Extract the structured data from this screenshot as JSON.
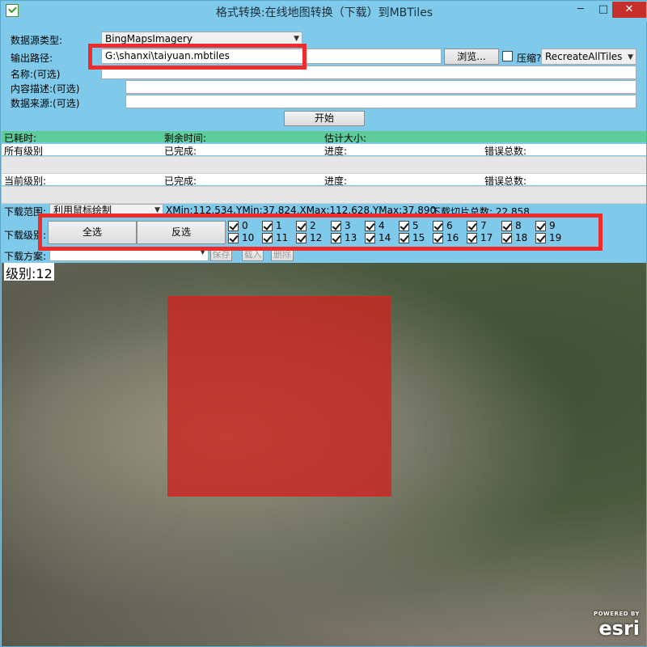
{
  "window": {
    "title": "格式转换:在线地图转换（下载）到MBTiles",
    "min": "─",
    "max": "□",
    "close": "✕"
  },
  "form": {
    "source_type_label": "数据源类型:",
    "source_type_value": "BingMapsImagery",
    "output_path_label": "输出路径:",
    "output_path_value": "G:\\shanxi\\taiyuan.mbtiles",
    "browse_button": "浏览...",
    "compress_label": "压缩?",
    "compress_checked": false,
    "mode_value": "RecreateAllTiles",
    "name_label": "名称:(可选)",
    "name_value": "",
    "description_label": "内容描述:(可选)",
    "description_value": "",
    "source_label": "数据来源:(可选)",
    "source_value": "",
    "start_button": "开始"
  },
  "progress": {
    "elapsed_label": "已耗时:",
    "remaining_label": "剩余时间:",
    "estimated_size_label": "估计大小:",
    "all_levels_label": "所有级别",
    "current_level_label": "当前级别:",
    "completed_label": "已完成:",
    "progress_label": "进度:",
    "errors_label": "错误总数:"
  },
  "download": {
    "range_label": "下载范围:",
    "range_value": "利用鼠标绘制",
    "extent_text": "XMin:112.534,YMin:37.824,XMax:112.628,YMax:37.890",
    "tile_count_text": "下载切片总数: 22,858",
    "levels_label": "下载级别:",
    "select_all_button": "全选",
    "invert_button": "反选",
    "levels_row1": [
      "0",
      "1",
      "2",
      "3",
      "4",
      "5",
      "6",
      "7",
      "8",
      "9"
    ],
    "levels_row2": [
      "10",
      "11",
      "12",
      "13",
      "14",
      "15",
      "16",
      "17",
      "18",
      "19"
    ],
    "scheme_label": "下载方案:",
    "scheme_value": "",
    "save_button": "保存",
    "load_button": "载入",
    "delete_button": "删除"
  },
  "map": {
    "level_text": "级别:12",
    "attribution_powered": "POWERED BY",
    "attribution_brand": "esri"
  },
  "colors": {
    "window_bg": "#7fc9ea",
    "status_bar": "#5dcc9a",
    "highlight_red": "#ee2c2c",
    "selection_fill": "#cd231e"
  }
}
